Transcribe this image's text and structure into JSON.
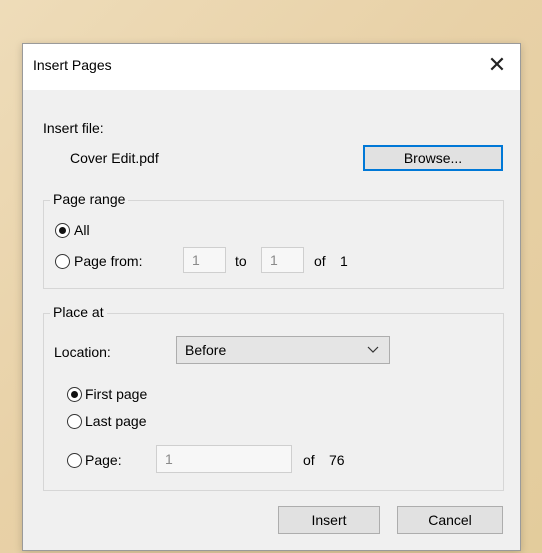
{
  "dialog": {
    "title": "Insert Pages",
    "close_glyph": "✕"
  },
  "insert_file": {
    "label": "Insert file:",
    "filename": "Cover Edit.pdf",
    "browse_label": "Browse..."
  },
  "page_range": {
    "title": "Page range",
    "all_label": "All",
    "page_from_label": "Page from:",
    "from_value": "1",
    "to_label": "to",
    "to_value": "1",
    "of_label": "of",
    "total": "1"
  },
  "place_at": {
    "title": "Place at",
    "location_label": "Location:",
    "location_value": "Before",
    "first_page_label": "First page",
    "last_page_label": "Last page",
    "page_label": "Page:",
    "page_value": "1",
    "of_label": "of",
    "total": "76"
  },
  "buttons": {
    "insert": "Insert",
    "cancel": "Cancel"
  }
}
